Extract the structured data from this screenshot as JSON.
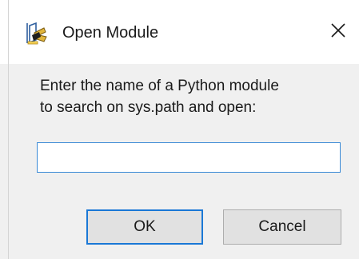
{
  "window": {
    "title": "Open Module",
    "app_icon": "idle-python-icon",
    "close_icon": "close-icon"
  },
  "prompt": {
    "line1": "Enter the name of a Python module",
    "line2": "to search on sys.path and open:"
  },
  "module_input": {
    "value": "",
    "placeholder": ""
  },
  "buttons": {
    "ok_label": "OK",
    "cancel_label": "Cancel"
  },
  "colors": {
    "focus_accent": "#1a78d6",
    "dialog_background": "#f0f0f0",
    "title_background": "#ffffff"
  }
}
